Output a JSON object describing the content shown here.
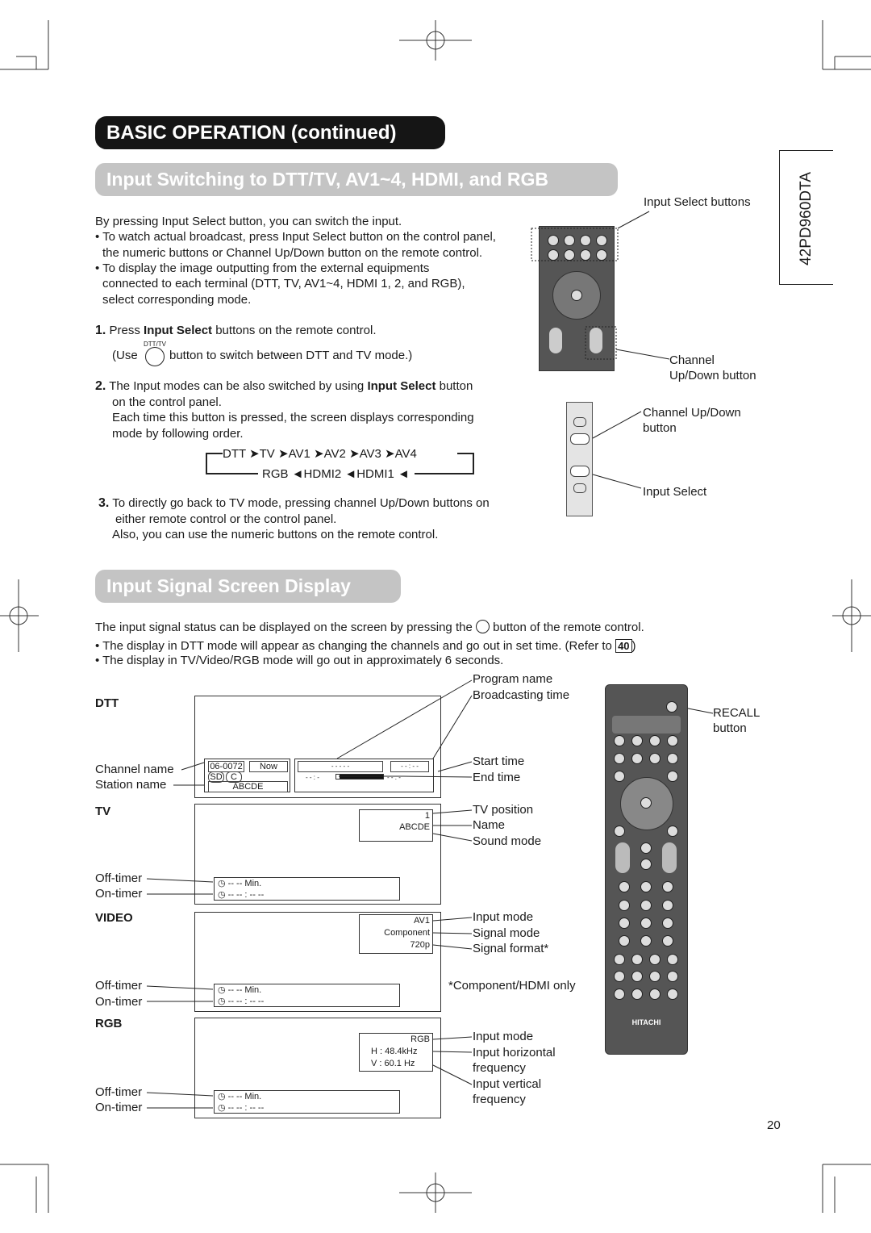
{
  "header": {
    "title": "BASIC OPERATION (continued)",
    "model": "42PD960DTA"
  },
  "section1": {
    "title": "Input Switching to DTT/TV, AV1~4, HDMI, and RGB",
    "intro": "By pressing Input Select button, you can switch the input.",
    "bullets": [
      [
        "• To watch actual broadcast, press Input Select button on the control panel,",
        "the numeric buttons or Channel Up/Down button on the remote control."
      ],
      [
        "• To display the image outputting from the external equipments",
        "connected to each terminal (DTT, TV, AV1~4, HDMI 1, 2, and RGB),",
        "select corresponding mode."
      ]
    ],
    "step1": {
      "num": "1.",
      "pre": "Press ",
      "bold": "Input Select",
      "post": " buttons on the remote control.",
      "icon_label": "DTT/TV",
      "use_pre": "(Use",
      "use_post": "button to switch between DTT and TV mode.)"
    },
    "step2": {
      "num": "2.",
      "pre": "The Input modes can be also switched by using ",
      "bold": "Input Select",
      "post": " button",
      "lines": [
        "on the control panel.",
        "Each time this button is pressed, the screen displays corresponding",
        "mode by following order."
      ]
    },
    "flow": {
      "top": [
        "DTT",
        "TV",
        "AV1",
        "AV2",
        "AV3",
        "AV4"
      ],
      "bottom": [
        "RGB",
        "HDMI2",
        "HDMI1"
      ]
    },
    "step3": {
      "num": "3.",
      "lines": [
        "To directly go back to TV mode, pressing channel Up/Down buttons on",
        "either remote control or the control panel.",
        "Also, you can use the numeric buttons on the remote control."
      ]
    },
    "callouts": {
      "input_select_buttons": "Input Select buttons",
      "channel_updown": [
        "Channel",
        "Up/Down button"
      ],
      "panel_channel": [
        "Channel Up/Down",
        "button"
      ],
      "panel_input_select": "Input Select"
    }
  },
  "section2": {
    "title": "Input Signal Screen Display",
    "intro_pre": "The input signal status can be displayed on the screen by pressing the",
    "intro_post": "button of the remote control.",
    "bullet1_pre": "• The display in DTT mode will appear as changing the channels and go out in set time. (Refer to",
    "bullet1_ref": "40",
    "bullet1_post": ")",
    "bullet2": "• The display in TV/Video/RGB mode will go out in approximately 6 seconds.",
    "recall": [
      "RECALL",
      "button"
    ],
    "footnote": "*Component/HDMI only",
    "dtt": {
      "label": "DTT",
      "channel": "06-0072",
      "now": "Now",
      "sd": "SD",
      "c": "C",
      "station": "ABCDE",
      "program": "- - - - -",
      "btime": "- - : - -",
      "start": "- - : -",
      "end": "- - : -",
      "left_labels": [
        "Channel name",
        "Station name"
      ],
      "right_labels": [
        "Program name",
        "Broadcasting time",
        "Start time",
        "End time"
      ]
    },
    "tv": {
      "label": "TV",
      "position": "1",
      "name": "ABCDE",
      "right_labels": [
        "TV position",
        "Name",
        "Sound mode"
      ],
      "left_labels": [
        "Off-timer",
        "On-timer"
      ],
      "off": "-- -- Min.",
      "on": "-- -- : -- --"
    },
    "video": {
      "label": "VIDEO",
      "mode": "AV1",
      "signal": "Component",
      "format": "720p",
      "right_labels": [
        "Input mode",
        "Signal mode",
        "Signal format*"
      ],
      "left_labels": [
        "Off-timer",
        "On-timer"
      ],
      "off": "-- -- Min.",
      "on": "-- -- : -- --"
    },
    "rgb": {
      "label": "RGB",
      "mode": "RGB",
      "h": "H :   48.4kHz",
      "v": "V :   60.1  Hz",
      "right_labels": [
        "Input mode",
        "Input horizontal",
        "frequency",
        "Input vertical",
        "frequency"
      ],
      "left_labels": [
        "Off-timer",
        "On-timer"
      ],
      "off": "-- -- Min.",
      "on": "-- -- : -- --"
    }
  },
  "remote": {
    "brand": "HITACHI"
  },
  "page_number": "20"
}
